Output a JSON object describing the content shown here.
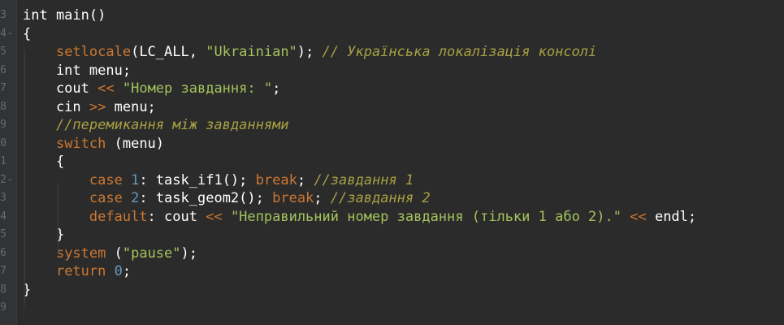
{
  "line_numbers": [
    "2",
    "3",
    "4",
    "5",
    "6",
    "7",
    "8",
    "9",
    "0",
    "1",
    "2",
    "3",
    "4",
    "5",
    "6",
    "7",
    "8",
    "9"
  ],
  "lines": [
    [
      {
        "t": "",
        "c": "pl"
      }
    ],
    [
      {
        "t": "int main()",
        "c": "kw"
      }
    ],
    [
      {
        "t": "{",
        "c": "pl"
      }
    ],
    [
      {
        "t": "    ",
        "c": "pl"
      },
      {
        "t": "setlocale",
        "c": "fn"
      },
      {
        "t": "(LC_ALL, ",
        "c": "pl"
      },
      {
        "t": "\"Ukrainian\"",
        "c": "str"
      },
      {
        "t": "); ",
        "c": "pl"
      },
      {
        "t": "// Українська локалізація консолі",
        "c": "cmt"
      }
    ],
    [
      {
        "t": "    int menu;",
        "c": "pl"
      }
    ],
    [
      {
        "t": "    cout ",
        "c": "pl"
      },
      {
        "t": "<<",
        "c": "op"
      },
      {
        "t": " ",
        "c": "pl"
      },
      {
        "t": "\"Номер завдання: \"",
        "c": "str"
      },
      {
        "t": ";",
        "c": "pl"
      }
    ],
    [
      {
        "t": "    cin ",
        "c": "pl"
      },
      {
        "t": ">>",
        "c": "op"
      },
      {
        "t": " menu;",
        "c": "pl"
      }
    ],
    [
      {
        "t": "    ",
        "c": "pl"
      },
      {
        "t": "//перемикання між завданнями",
        "c": "cmt"
      }
    ],
    [
      {
        "t": "    ",
        "c": "pl"
      },
      {
        "t": "switch",
        "c": "fn"
      },
      {
        "t": " (menu)",
        "c": "pl"
      }
    ],
    [
      {
        "t": "    {",
        "c": "pl"
      }
    ],
    [
      {
        "t": "        ",
        "c": "pl"
      },
      {
        "t": "case",
        "c": "fn"
      },
      {
        "t": " ",
        "c": "pl"
      },
      {
        "t": "1",
        "c": "num"
      },
      {
        "t": ": task_if1(); ",
        "c": "pl"
      },
      {
        "t": "break",
        "c": "fn"
      },
      {
        "t": "; ",
        "c": "pl"
      },
      {
        "t": "//завдання 1",
        "c": "cmt"
      }
    ],
    [
      {
        "t": "        ",
        "c": "pl"
      },
      {
        "t": "case",
        "c": "fn"
      },
      {
        "t": " ",
        "c": "pl"
      },
      {
        "t": "2",
        "c": "num"
      },
      {
        "t": ": task_geom2(); ",
        "c": "pl"
      },
      {
        "t": "break",
        "c": "fn"
      },
      {
        "t": "; ",
        "c": "pl"
      },
      {
        "t": "//завдання 2",
        "c": "cmt"
      }
    ],
    [
      {
        "t": "        ",
        "c": "pl"
      },
      {
        "t": "default",
        "c": "fn"
      },
      {
        "t": ": cout ",
        "c": "pl"
      },
      {
        "t": "<<",
        "c": "op"
      },
      {
        "t": " ",
        "c": "pl"
      },
      {
        "t": "\"Неправильний номер завдання (тільки 1 або 2).\"",
        "c": "str"
      },
      {
        "t": " ",
        "c": "pl"
      },
      {
        "t": "<<",
        "c": "op"
      },
      {
        "t": " endl;",
        "c": "pl"
      }
    ],
    [
      {
        "t": "    }",
        "c": "pl"
      }
    ],
    [
      {
        "t": "    ",
        "c": "pl"
      },
      {
        "t": "system",
        "c": "fn"
      },
      {
        "t": " (",
        "c": "pl"
      },
      {
        "t": "\"pause\"",
        "c": "str"
      },
      {
        "t": ");",
        "c": "pl"
      }
    ],
    [
      {
        "t": "    ",
        "c": "pl"
      },
      {
        "t": "return",
        "c": "fn"
      },
      {
        "t": " ",
        "c": "pl"
      },
      {
        "t": "0",
        "c": "num"
      },
      {
        "t": ";",
        "c": "pl"
      }
    ],
    [
      {
        "t": "}",
        "c": "pl"
      }
    ],
    [
      {
        "t": "",
        "c": "pl"
      }
    ]
  ],
  "colors": {
    "background": "#2b2b2b",
    "keyword": "#cc7832",
    "string": "#a5c25c",
    "comment": "#a8a044",
    "number": "#6897bb"
  }
}
